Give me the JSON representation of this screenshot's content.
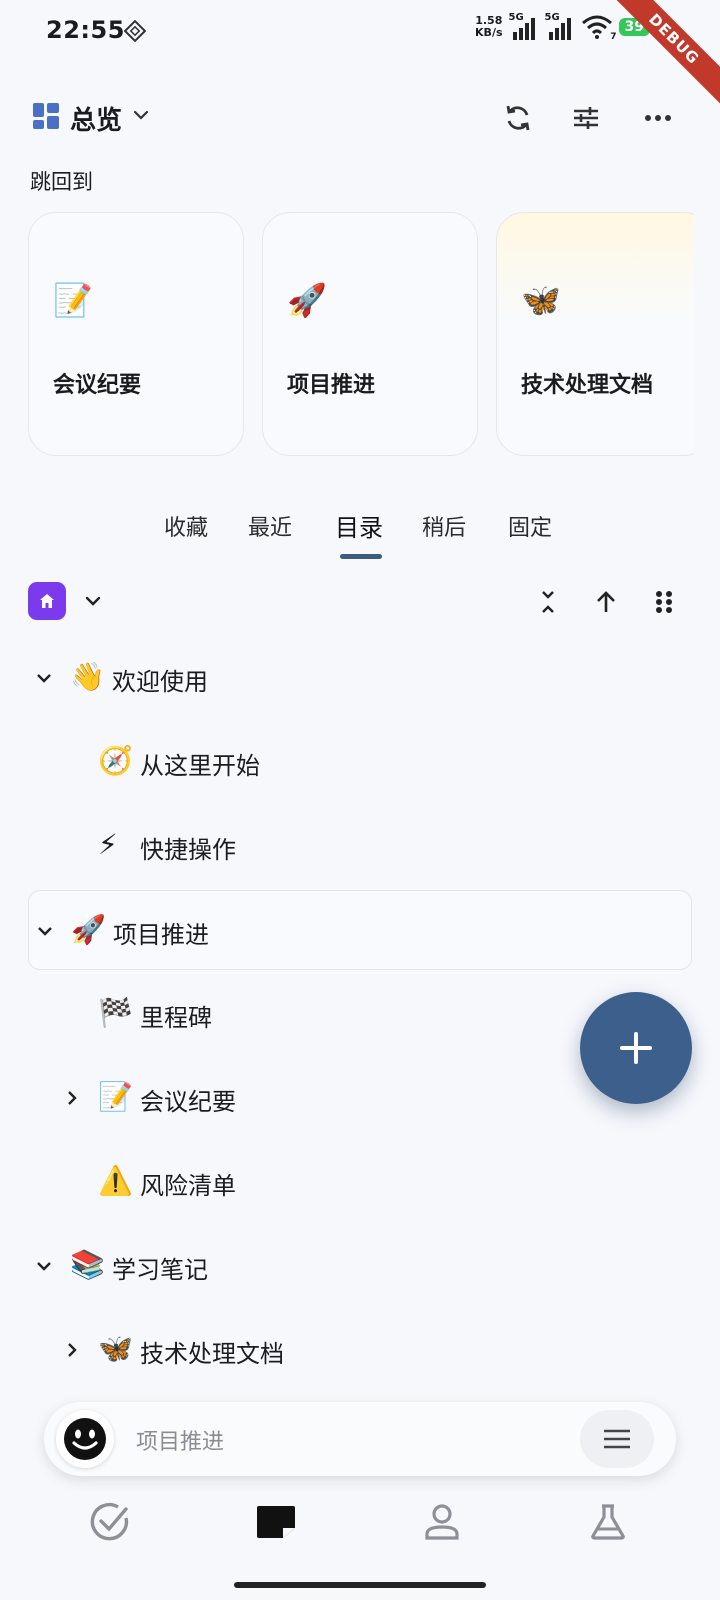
{
  "status_bar": {
    "time": "22:55",
    "net_speed_value": "1.58",
    "net_speed_unit": "KB/s",
    "signal_1_label": "5G",
    "signal_2_label": "5G",
    "wifi_badge": "7",
    "battery": "39",
    "debug_label": "DEBUG"
  },
  "app_bar": {
    "title": "总览",
    "icons": [
      "grid-view-icon",
      "chevron-down-icon",
      "sync-icon",
      "tune-icon",
      "more-horizontal-icon"
    ]
  },
  "jump_back": {
    "label": "跳回到",
    "cards": [
      {
        "emoji": "📝",
        "title": "会议纪要"
      },
      {
        "emoji": "🚀",
        "title": "项目推进"
      },
      {
        "emoji": "🦋",
        "title": "技术处理文档"
      }
    ]
  },
  "tabs": {
    "items": [
      "收藏",
      "最近",
      "目录",
      "稍后",
      "固定"
    ],
    "active": "目录"
  },
  "tree": {
    "rows": [
      {
        "emoji": "👋",
        "text": "欢迎使用",
        "expander": "expanded"
      },
      {
        "emoji": "🧭",
        "text": "从这里开始",
        "expander": "none"
      },
      {
        "emoji": "⚡",
        "text": "快捷操作",
        "expander": "none"
      },
      {
        "emoji": "🚀",
        "text": "项目推进",
        "expander": "expanded"
      },
      {
        "emoji": "🏁",
        "text": "里程碑",
        "expander": "none"
      },
      {
        "emoji": "📝",
        "text": "会议纪要",
        "expander": "collapsed"
      },
      {
        "emoji": "⚠️",
        "text": "风险清单",
        "expander": "none"
      },
      {
        "emoji": "📚",
        "text": "学习笔记",
        "expander": "expanded"
      },
      {
        "emoji": "🦋",
        "text": "技术处理文档",
        "expander": "collapsed"
      }
    ]
  },
  "bottom_pill": {
    "text": "项目推进"
  },
  "bottom_nav": {
    "items": [
      "check-circle-icon",
      "note-icon",
      "person-icon",
      "flask-icon"
    ],
    "active": "note-icon"
  },
  "colors": {
    "accent": "#3d5a80",
    "fab": "#3d5f8c",
    "home_badge": "#7c3aed",
    "battery": "#34c759",
    "debug": "#c0392b"
  }
}
